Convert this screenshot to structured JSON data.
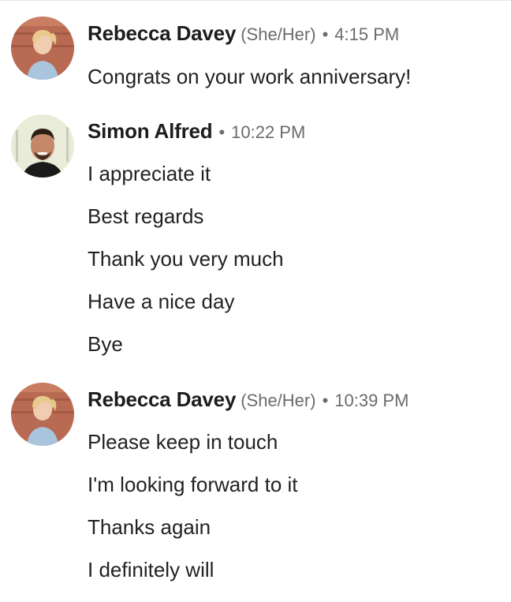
{
  "conversation": {
    "groups": [
      {
        "sender": "Rebecca Davey",
        "pronouns": "(She/Her)",
        "separator": "•",
        "time": "4:15 PM",
        "messages": [
          "Congrats on your work anniversary!"
        ]
      },
      {
        "sender": "Simon Alfred",
        "pronouns": "",
        "separator": "•",
        "time": "10:22 PM",
        "messages": [
          "I appreciate it",
          "Best regards",
          "Thank you very much",
          "Have a nice day",
          "Bye"
        ]
      },
      {
        "sender": "Rebecca Davey",
        "pronouns": "(She/Her)",
        "separator": "•",
        "time": "10:39 PM",
        "messages": [
          "Please keep in touch",
          "I'm looking forward to it",
          "Thanks again",
          "I definitely will"
        ]
      }
    ]
  },
  "colors": {
    "name": "#1d1d1d",
    "meta": "#6b6b6b",
    "message": "#222222"
  }
}
